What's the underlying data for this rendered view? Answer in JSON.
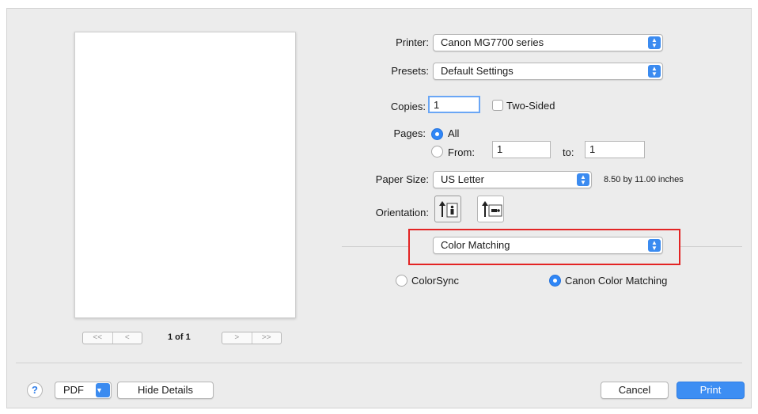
{
  "printer": {
    "label": "Printer:",
    "value": "Canon MG7700 series"
  },
  "presets": {
    "label": "Presets:",
    "value": "Default Settings"
  },
  "copies": {
    "label": "Copies:",
    "value": "1",
    "two_sided_label": "Two-Sided",
    "two_sided_checked": false
  },
  "pages": {
    "label": "Pages:",
    "all_label": "All",
    "from_label": "From:",
    "from_value": "1",
    "to_label": "to:",
    "to_value": "1",
    "selected": "All"
  },
  "paper_size": {
    "label": "Paper Size:",
    "value": "US Letter",
    "dimensions": "8.50 by 11.00 inches"
  },
  "orientation": {
    "label": "Orientation:",
    "options": [
      "portrait",
      "landscape"
    ],
    "selected": "portrait"
  },
  "section": {
    "value": "Color Matching"
  },
  "color_matching": {
    "option1": "ColorSync",
    "option2": "Canon Color Matching",
    "selected": "Canon Color Matching"
  },
  "preview": {
    "first_label": "<<",
    "prev_label": "<",
    "next_label": ">",
    "last_label": ">>",
    "page_count": "1 of 1"
  },
  "footer": {
    "help_label": "?",
    "pdf_label": "PDF",
    "hide_details_label": "Hide Details",
    "cancel_label": "Cancel",
    "print_label": "Print"
  },
  "colors": {
    "accent": "#3b8bf0",
    "highlight": "#e32424"
  }
}
